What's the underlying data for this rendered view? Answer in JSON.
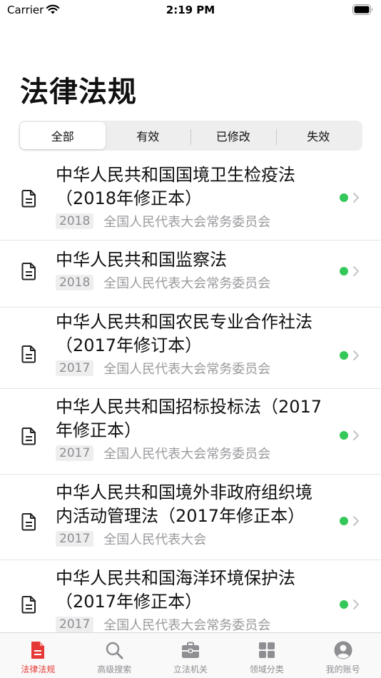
{
  "status_bar": {
    "carrier": "Carrier",
    "time": "2:19 PM"
  },
  "page": {
    "title": "法律法规"
  },
  "segments": [
    {
      "label": "全部",
      "active": true
    },
    {
      "label": "有效",
      "active": false
    },
    {
      "label": "已修改",
      "active": false
    },
    {
      "label": "失效",
      "active": false
    }
  ],
  "laws": [
    {
      "title_line1": "中华人民共和国国境卫生检疫法",
      "title_line2": "（2018年修正本）",
      "year": "2018",
      "org": "全国人民代表大会常务委员会",
      "status_color": "#34c759"
    },
    {
      "title_line1": "中华人民共和国监察法",
      "title_line2": "",
      "year": "2018",
      "org": "全国人民代表大会常务委员会",
      "status_color": "#34c759"
    },
    {
      "title_line1": "中华人民共和国农民专业合作社法",
      "title_line2": "（2017年修订本）",
      "year": "2017",
      "org": "全国人民代表大会常务委员会",
      "status_color": "#34c759"
    },
    {
      "title_line1": "中华人民共和国招标投标法（2017",
      "title_line2": "年修正本）",
      "year": "2017",
      "org": "全国人民代表大会常务委员会",
      "status_color": "#34c759"
    },
    {
      "title_line1": "中华人民共和国境外非政府组织境",
      "title_line2": "内活动管理法（2017年修正本）",
      "year": "2017",
      "org": "全国人民代表大会",
      "status_color": "#34c759"
    },
    {
      "title_line1": "中华人民共和国海洋环境保护法",
      "title_line2": "（2017年修正本）",
      "year": "2017",
      "org": "全国人民代表大会常务委员会",
      "status_color": "#34c759"
    }
  ],
  "tabs": [
    {
      "label": "法律法规",
      "icon": "document-icon",
      "active": true
    },
    {
      "label": "高级搜索",
      "icon": "search-icon",
      "active": false
    },
    {
      "label": "立法机关",
      "icon": "briefcase-icon",
      "active": false
    },
    {
      "label": "领域分类",
      "icon": "grid-icon",
      "active": false
    },
    {
      "label": "我的账号",
      "icon": "person-icon",
      "active": false
    }
  ],
  "colors": {
    "accent": "#e53935",
    "status_green": "#34c759",
    "inactive": "#8e8e93"
  }
}
